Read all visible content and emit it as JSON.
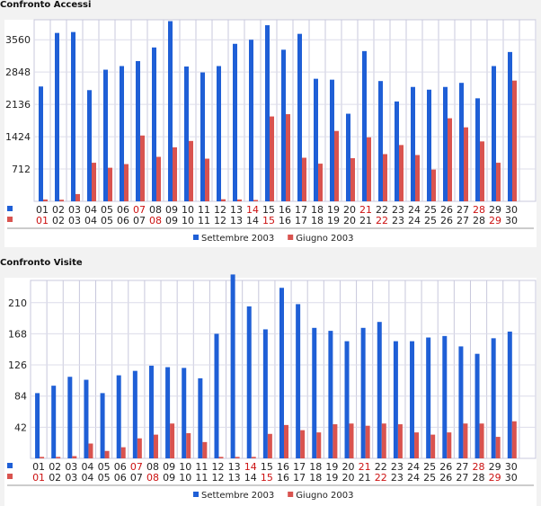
{
  "charts": [
    {
      "title": "Confronto Accessi",
      "chart_data": {
        "type": "bar",
        "ylim": [
          0,
          4000
        ],
        "yticks": [
          "712",
          "1424",
          "2136",
          "2848",
          "3560"
        ],
        "categories": [
          "01",
          "02",
          "03",
          "04",
          "05",
          "06",
          "07",
          "08",
          "09",
          "10",
          "11",
          "12",
          "13",
          "14",
          "15",
          "16",
          "17",
          "18",
          "19",
          "20",
          "21",
          "22",
          "23",
          "24",
          "25",
          "26",
          "27",
          "28",
          "29",
          "30"
        ],
        "categories_prev": [
          "01",
          "02",
          "03",
          "04",
          "05",
          "06",
          "07",
          "08",
          "09",
          "10",
          "11",
          "12",
          "13",
          "14",
          "15",
          "16",
          "17",
          "18",
          "19",
          "20",
          "21",
          "22",
          "23",
          "24",
          "25",
          "26",
          "27",
          "28",
          "29",
          "30"
        ],
        "red_days_curr": [
          "07",
          "14",
          "21",
          "28"
        ],
        "red_days_prev": [
          "01",
          "08",
          "15",
          "22",
          "29"
        ],
        "series": [
          {
            "name": "Settembre 2003",
            "color": "#1f5fd6",
            "values": [
              2530,
              3710,
              3730,
              2450,
              2900,
              2980,
              3090,
              3390,
              3970,
              2970,
              2840,
              2980,
              3470,
              3560,
              3880,
              3340,
              3690,
              2700,
              2680,
              1930,
              3310,
              2650,
              2200,
              2520,
              2460,
              2520,
              2610,
              2270,
              2980,
              3290
            ]
          },
          {
            "name": "Giugno 2003",
            "color": "#d9534f",
            "values": [
              40,
              35,
              160,
              850,
              740,
              820,
              1450,
              980,
              1190,
              1330,
              940,
              45,
              40,
              30,
              1870,
              1920,
              960,
              830,
              1550,
              950,
              1410,
              1040,
              1240,
              1020,
              700,
              1830,
              1630,
              1320,
              850,
              2660
            ]
          }
        ]
      }
    },
    {
      "title": "Confronto Visite",
      "chart_data": {
        "type": "bar",
        "ylim": [
          0,
          240
        ],
        "yticks": [
          "42",
          "84",
          "126",
          "168",
          "210"
        ],
        "categories": [
          "01",
          "02",
          "03",
          "04",
          "05",
          "06",
          "07",
          "08",
          "09",
          "10",
          "11",
          "12",
          "13",
          "14",
          "15",
          "16",
          "17",
          "18",
          "19",
          "20",
          "21",
          "22",
          "23",
          "24",
          "25",
          "26",
          "27",
          "28",
          "29",
          "30"
        ],
        "categories_prev": [
          "01",
          "02",
          "03",
          "04",
          "05",
          "06",
          "07",
          "08",
          "09",
          "10",
          "11",
          "12",
          "13",
          "14",
          "15",
          "16",
          "17",
          "18",
          "19",
          "20",
          "21",
          "22",
          "23",
          "24",
          "25",
          "26",
          "27",
          "28",
          "29",
          "30"
        ],
        "red_days_curr": [
          "07",
          "14",
          "21",
          "28"
        ],
        "red_days_prev": [
          "01",
          "08",
          "15",
          "22",
          "29"
        ],
        "series": [
          {
            "name": "Settembre 2003",
            "color": "#1f5fd6",
            "values": [
              88,
              98,
              110,
              106,
              88,
              112,
              118,
              125,
              123,
              122,
              108,
              168,
              248,
              205,
              174,
              230,
              208,
              176,
              172,
              158,
              176,
              184,
              158,
              158,
              163,
              165,
              151,
              141,
              162,
              171
            ]
          },
          {
            "name": "Giugno 2003",
            "color": "#d9534f",
            "values": [
              2,
              2,
              3,
              20,
              10,
              15,
              27,
              32,
              47,
              34,
              22,
              2,
              2,
              2,
              33,
              45,
              38,
              35,
              46,
              47,
              44,
              47,
              46,
              35,
              32,
              35,
              47,
              47,
              29,
              50
            ]
          }
        ]
      }
    }
  ]
}
